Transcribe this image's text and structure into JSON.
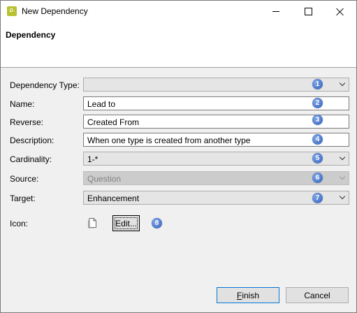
{
  "window": {
    "title": "New Dependency",
    "controls": {
      "minimize": "minimize",
      "maximize": "maximize",
      "close": "close"
    }
  },
  "header": {
    "title": "Dependency"
  },
  "form": {
    "dependency_type": {
      "label": "Dependency Type:",
      "value": "",
      "badge": "1"
    },
    "name": {
      "label": "Name:",
      "value": "Lead to",
      "badge": "2"
    },
    "reverse": {
      "label": "Reverse:",
      "value": "Created From",
      "badge": "3"
    },
    "description": {
      "label": "Description:",
      "value": "When one type is created from another type",
      "badge": "4"
    },
    "cardinality": {
      "label": "Cardinality:",
      "value": "1-*",
      "badge": "5"
    },
    "source": {
      "label": "Source:",
      "value": "Question",
      "badge": "6",
      "disabled": true
    },
    "target": {
      "label": "Target:",
      "value": "Enhancement",
      "badge": "7"
    },
    "icon": {
      "label": "Icon:",
      "edit_button": "Edit...",
      "badge": "8",
      "preview_icon": "document-icon"
    }
  },
  "footer": {
    "finish_first": "F",
    "finish_rest": "inish",
    "cancel": "Cancel"
  },
  "colors": {
    "badge": "#3a6cc4",
    "accent": "#0078d7",
    "app_icon": "#b8c232"
  }
}
